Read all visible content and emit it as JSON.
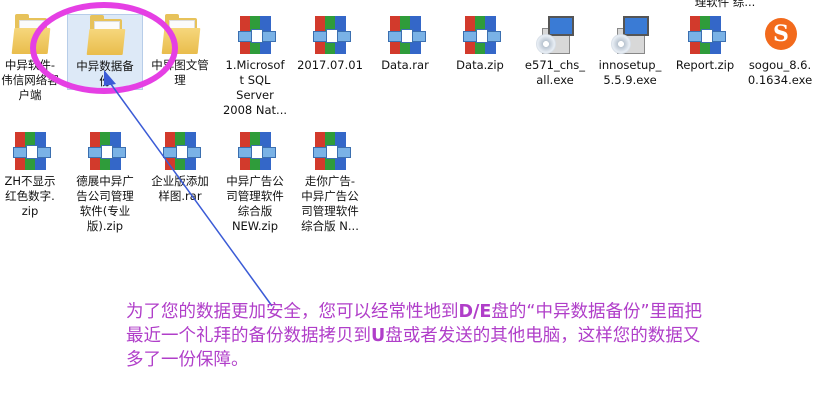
{
  "desktop": {
    "top_clipped_label": "理软件 综...",
    "row1": [
      {
        "type": "folder",
        "lines": [
          "中异软件-",
          "伟信网络客",
          "户端"
        ]
      },
      {
        "type": "folder",
        "lines": [
          "中异数据备",
          "份"
        ],
        "selected": true
      },
      {
        "type": "folder",
        "lines": [
          "中异图文管",
          "理"
        ]
      },
      {
        "type": "rar",
        "lines": [
          "1.Microsof",
          "t SQL",
          "Server",
          "2008 Nat..."
        ]
      },
      {
        "type": "rar",
        "lines": [
          "2017.07.01"
        ]
      },
      {
        "type": "rar",
        "lines": [
          "Data.rar"
        ]
      },
      {
        "type": "rar",
        "lines": [
          "Data.zip"
        ]
      },
      {
        "type": "exe",
        "lines": [
          "e571_chs_",
          "all.exe"
        ]
      },
      {
        "type": "exe",
        "lines": [
          "innosetup_",
          "5.5.9.exe"
        ]
      },
      {
        "type": "rar",
        "lines": [
          "Report.zip"
        ]
      },
      {
        "type": "sogou",
        "lines": [
          "sogou_8.6.",
          "0.1634.exe"
        ]
      }
    ],
    "row2": [
      {
        "type": "rar",
        "lines": [
          "ZH不显示",
          "红色数字.",
          "zip"
        ]
      },
      {
        "type": "rar",
        "lines": [
          "德展中异广",
          "告公司管理",
          "软件(专业",
          "版).zip"
        ]
      },
      {
        "type": "rar",
        "lines": [
          "企业版添加",
          "样图.rar"
        ]
      },
      {
        "type": "rar",
        "lines": [
          "中异广告公",
          "司管理软件",
          "综合版",
          "NEW.zip"
        ]
      },
      {
        "type": "rar",
        "lines": [
          "走你广告-",
          "中异广告公",
          "司管理软件",
          "综合版 N..."
        ]
      }
    ]
  },
  "annotation": {
    "line1_a": "为了您的数据更加安全，您可以经常性地到",
    "line1_b": "D/E",
    "line1_c": "盘的“中异数据备份”里面把",
    "line2_a": "最近一个礼拜的备份数据拷贝到",
    "line2_b": "U",
    "line2_c": "盘或者发送的其他电脑，这样您的数据又",
    "line3": "多了一份保障。",
    "color": "#b03ec9",
    "ellipse_color": "#e53fe4",
    "arrow_color": "#3b5bd6"
  }
}
